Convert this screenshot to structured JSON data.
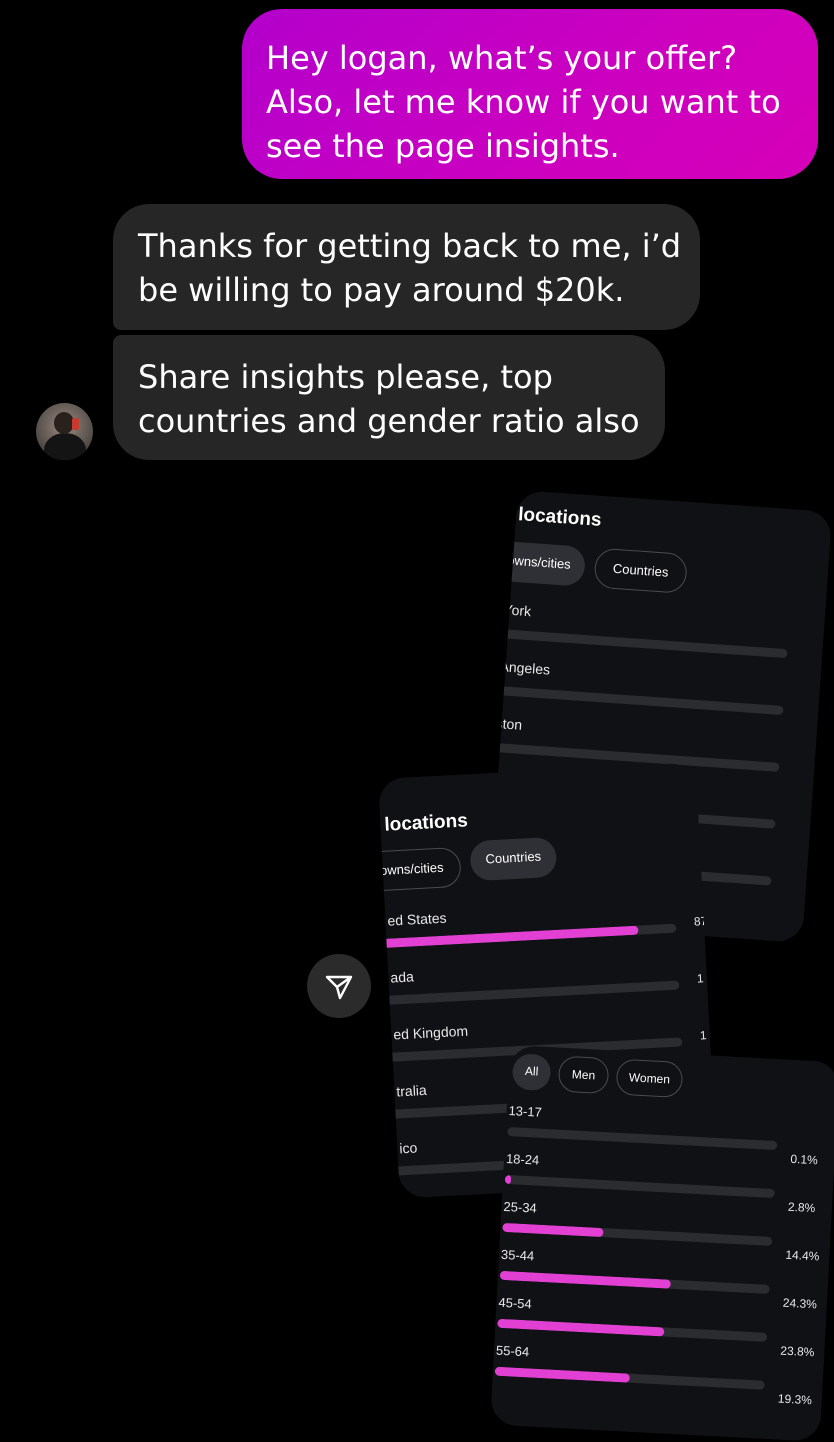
{
  "messages": {
    "sent": {
      "line1": "Hey logan, what’s your offer?",
      "line2": "Also, let me know if you want to",
      "line3": "see the page insights."
    },
    "received1": {
      "line1": "Thanks for getting back to me, i’d",
      "line2": "be willing to pay around $20k."
    },
    "received2": {
      "line1": "Share insights please, top",
      "line2": "countries and gender ratio also"
    }
  },
  "icons": {
    "avatar": "profile-avatar",
    "reply": "reply-send-icon"
  },
  "card_cities": {
    "title": "locations",
    "tab_cities": "owns/cities",
    "tab_countries": "Countries",
    "rows": [
      {
        "label": "York",
        "value": 0
      },
      {
        "label": "Angeles",
        "value": 0
      },
      {
        "label": "ston",
        "value": 0
      },
      {
        "label": "",
        "value": 0
      },
      {
        "label": "",
        "value": 0
      }
    ]
  },
  "card_countries": {
    "title": "locations",
    "tab_cities": "owns/cities",
    "tab_countries": "Countries",
    "rows": [
      {
        "label": "ed States",
        "value": 0.87,
        "pct": "87"
      },
      {
        "label": "ada",
        "value": 0,
        "pct": "1"
      },
      {
        "label": "ed Kingdom",
        "value": 0,
        "pct": "1"
      },
      {
        "label": "tralia",
        "value": 0,
        "pct": ""
      },
      {
        "label": "ico",
        "value": 0,
        "pct": ""
      }
    ]
  },
  "card_age": {
    "tabs": [
      "All",
      "Men",
      "Women"
    ],
    "rows": [
      {
        "label": "13-17",
        "value": 0.1,
        "pct": "0.1%"
      },
      {
        "label": "18-24",
        "value": 2.8,
        "pct": "2.8%"
      },
      {
        "label": "25-34",
        "value": 14.4,
        "pct": "14.4%"
      },
      {
        "label": "35-44",
        "value": 24.3,
        "pct": "24.3%"
      },
      {
        "label": "45-54",
        "value": 23.8,
        "pct": "23.8%"
      },
      {
        "label": "55-64",
        "value": 19.3,
        "pct": "19.3%"
      }
    ],
    "accent": "#e23fd3"
  }
}
